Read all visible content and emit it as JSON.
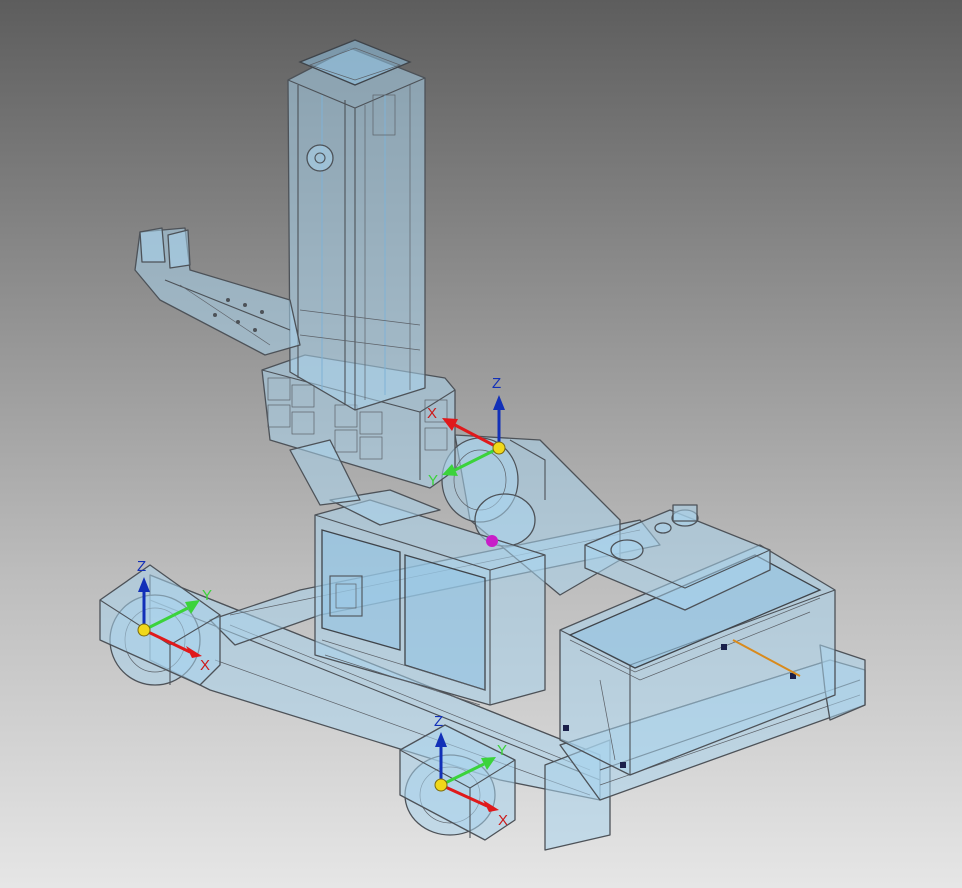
{
  "viewport": {
    "background_top": "#5d5d5d",
    "background_bottom": "#e6e6e6",
    "model_fill": "#a9d3ec",
    "model_edge": "#4d5258"
  },
  "triads": [
    {
      "id": "triad-top-right",
      "labels": {
        "z": "Z",
        "x": "X",
        "y": "Y"
      }
    },
    {
      "id": "triad-left",
      "labels": {
        "z": "Z",
        "x": "X",
        "y": "Y"
      }
    },
    {
      "id": "triad-bottom",
      "labels": {
        "z": "Z",
        "x": "X",
        "y": "Y"
      }
    }
  ],
  "axis_colors": {
    "x": "#e0191b",
    "y": "#3bd33b",
    "z": "#1230b8",
    "origin": "#f1d81a",
    "x_label": "#cc1a1a",
    "z_label": "#1230b8"
  },
  "markers": {
    "center_of_mass_color": "#c81ec8"
  }
}
